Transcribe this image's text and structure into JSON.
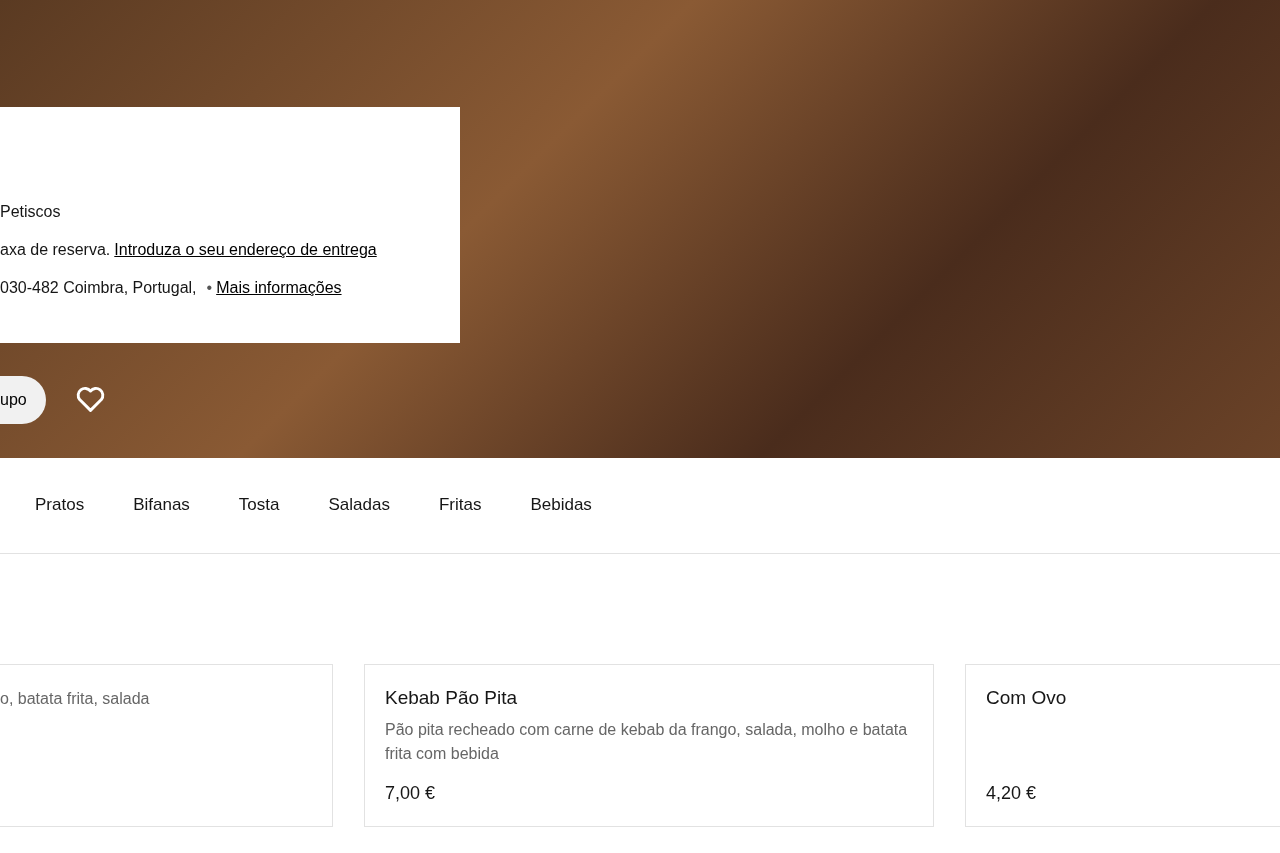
{
  "hero": {
    "info_card": {
      "category": "Petiscos",
      "fee_text": "axa de reserva.",
      "delivery_link": "Introduza o seu endereço de entrega",
      "address": "030-482 Coimbra, Portugal,",
      "separator": "•",
      "more_link": "Mais informações"
    },
    "group_button": "upo",
    "favorite": false
  },
  "tabs": [
    {
      "label": "Pratos",
      "selected": false
    },
    {
      "label": "Bifanas",
      "selected": false
    },
    {
      "label": "Tosta",
      "selected": false
    },
    {
      "label": "Saladas",
      "selected": false
    },
    {
      "label": "Fritas",
      "selected": false
    },
    {
      "label": "Bebidas",
      "selected": false
    }
  ],
  "items": [
    {
      "description": "o, batata frita, salada"
    },
    {
      "name": "Kebab Pão Pita",
      "description": "Pão pita recheado com carne de kebab da frango, salada, molho e batata frita com bebida",
      "price": "7,00 €"
    },
    {
      "name": "Com Ovo",
      "price": "4,20 €"
    }
  ]
}
